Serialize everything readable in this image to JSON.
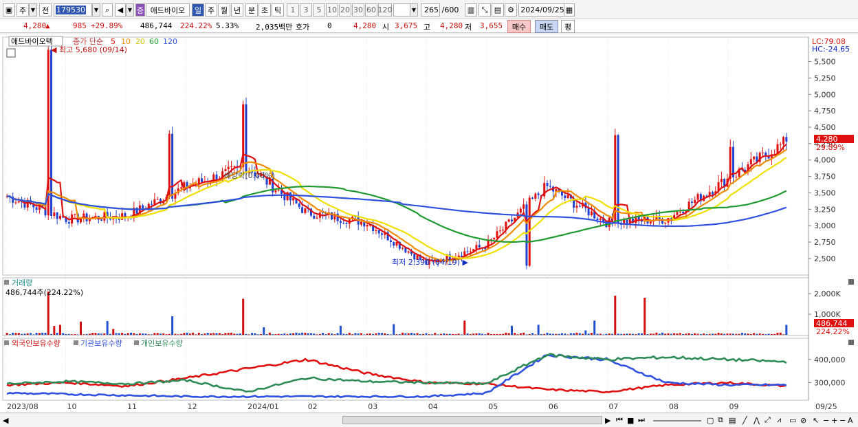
{
  "toolbar": {
    "mode_primary": "주",
    "mode_secondary": "전",
    "code": "179530",
    "stock_tag": "증",
    "stock_name": "애드바이오",
    "periods": [
      "일",
      "주",
      "월",
      "년",
      "분",
      "초",
      "틱"
    ],
    "active_period": "일",
    "intervals": [
      "1",
      "3",
      "5",
      "10",
      "20",
      "30",
      "60",
      "120"
    ],
    "count": "265",
    "count_total": "/600",
    "date": "2024/09/25"
  },
  "quote": {
    "price": "4,280",
    "change": "985",
    "change_rate": "+29.89%",
    "volume": "486,744",
    "volume_rate": "224.22%",
    "turnover_rate": "5.33%",
    "amount": "2,035백만",
    "hoga_label": "호가",
    "hoga_value": "0",
    "hoga_price": "4,280",
    "open_label": "시",
    "open": "3,675",
    "high_label": "고",
    "high": "4,280",
    "low_label": "저",
    "low": "3,655",
    "buy_label": "매수",
    "sell_label": "매도",
    "avg_label": "평"
  },
  "price_panel": {
    "stock_name": "애드바이오텍",
    "ma_label": "종가 단순",
    "ma_periods": [
      "5",
      "10",
      "20",
      "60",
      "120"
    ],
    "ma_colors": [
      "#e01010",
      "#f08c00",
      "#f0e000",
      "#1e9a30",
      "#3050e0"
    ],
    "high_marker": "최고 5,680 (09/14)",
    "low_marker": "최저 2,390 (04/19)",
    "dividend_marker": "배당락(0.00%)",
    "lc": "LC:79.08",
    "hc": "HC:-24.65",
    "current_price_tag": "4,280",
    "current_rate_tag": "29.89%",
    "y_ticks": [
      "5,500",
      "5,250",
      "5,000",
      "4,750",
      "4,500",
      "4,250",
      "4,000",
      "3,750",
      "3,500",
      "3,250",
      "3,000",
      "2,750",
      "2,500"
    ]
  },
  "volume_panel": {
    "title": "거래량",
    "value": "486,744주(224.22%)",
    "y_ticks": [
      "2,000K",
      "1,000K"
    ],
    "current_tag": "486,744",
    "current_rate_tag": "224.22%"
  },
  "holding_panel": {
    "series": [
      {
        "name": "외국인보유수량",
        "color": "#e01010"
      },
      {
        "name": "기관보유수량",
        "color": "#3050e0"
      },
      {
        "name": "개인보유수량",
        "color": "#2e8b57"
      }
    ],
    "y_ticks": [
      "400,000",
      "300,000"
    ]
  },
  "x_axis": [
    "2023/08",
    "10",
    "11",
    "12",
    "2024/01",
    "02",
    "03",
    "04",
    "05",
    "06",
    "07",
    "08",
    "09",
    "09/25"
  ],
  "chart_data": [
    {
      "type": "candlestick",
      "title": "애드바이오텍",
      "ylim": [
        2300,
        5600
      ],
      "x": [
        "2023/08",
        "10",
        "11",
        "12",
        "2024/01",
        "02",
        "03",
        "04",
        "05",
        "06",
        "07",
        "08",
        "09"
      ],
      "close_approx": [
        3450,
        3100,
        3150,
        3600,
        3900,
        3200,
        3050,
        2420,
        2700,
        3600,
        3050,
        3100,
        3700,
        4280
      ],
      "series": [
        {
          "name": "5",
          "color": "#e01010"
        },
        {
          "name": "10",
          "color": "#f08c00"
        },
        {
          "name": "20",
          "color": "#f0e000"
        },
        {
          "name": "60",
          "color": "#1e9a30"
        },
        {
          "name": "120",
          "color": "#3050e0"
        }
      ]
    },
    {
      "type": "bar",
      "title": "거래량",
      "ylim": [
        0,
        2500000
      ],
      "peaks": [
        2100000,
        900000,
        1750000,
        1900000,
        1800000,
        486744
      ]
    },
    {
      "type": "line",
      "series": [
        {
          "name": "외국인보유수량"
        },
        {
          "name": "기관보유수량"
        },
        {
          "name": "개인보유수량"
        }
      ],
      "ylim": [
        230000,
        450000
      ]
    }
  ]
}
